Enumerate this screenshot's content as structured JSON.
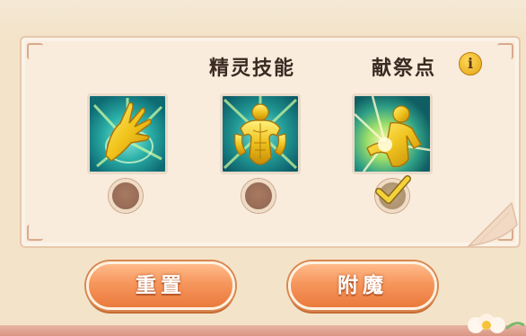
{
  "header": {
    "skill_label": "精灵技能",
    "sacrifice_label": "献祭点",
    "info_glyph": "i"
  },
  "skills": [
    {
      "icon": "golden-hand-icon",
      "selected": false
    },
    {
      "icon": "golden-muscle-figure-icon",
      "selected": false
    },
    {
      "icon": "golden-radiant-figure-icon",
      "selected": true
    }
  ],
  "buttons": {
    "reset_label": "重置",
    "enchant_label": "附魔"
  },
  "colors": {
    "panel": "#f9ecdc",
    "button_orange": "#f6965c",
    "icon_teal": "#2a9a9a",
    "icon_gold": "#f3c81f"
  }
}
